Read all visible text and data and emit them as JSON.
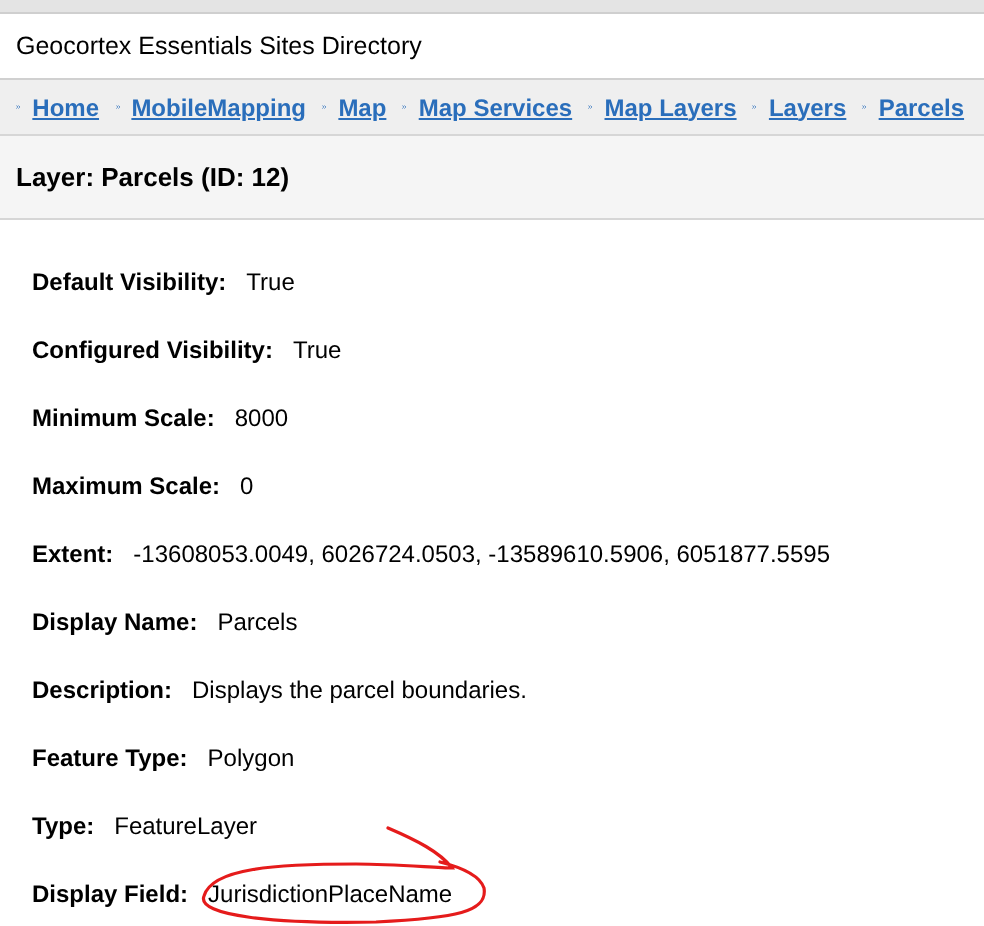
{
  "window": {
    "title": "Geocortex Essentials Sites Directory"
  },
  "breadcrumbs": [
    "Home",
    "MobileMapping",
    "Map",
    "Map Services",
    "Map Layers",
    "Layers",
    "Parcels"
  ],
  "heading": "Layer: Parcels (ID: 12)",
  "properties": [
    {
      "label": "Default Visibility:",
      "value": "True",
      "circled": false
    },
    {
      "label": "Configured Visibility:",
      "value": "True",
      "circled": false
    },
    {
      "label": "Minimum Scale:",
      "value": "8000",
      "circled": false
    },
    {
      "label": "Maximum Scale:",
      "value": "0",
      "circled": false
    },
    {
      "label": "Extent:",
      "value": "-13608053.0049, 6026724.0503, -13589610.5906, 6051877.5595",
      "circled": false
    },
    {
      "label": "Display Name:",
      "value": "Parcels",
      "circled": false
    },
    {
      "label": "Description:",
      "value": "Displays the parcel boundaries.",
      "circled": false
    },
    {
      "label": "Feature Type:",
      "value": "Polygon",
      "circled": false
    },
    {
      "label": "Type:",
      "value": "FeatureLayer",
      "circled": false
    },
    {
      "label": "Display Field:",
      "value": "JurisdictionPlaceName",
      "circled": true
    }
  ]
}
